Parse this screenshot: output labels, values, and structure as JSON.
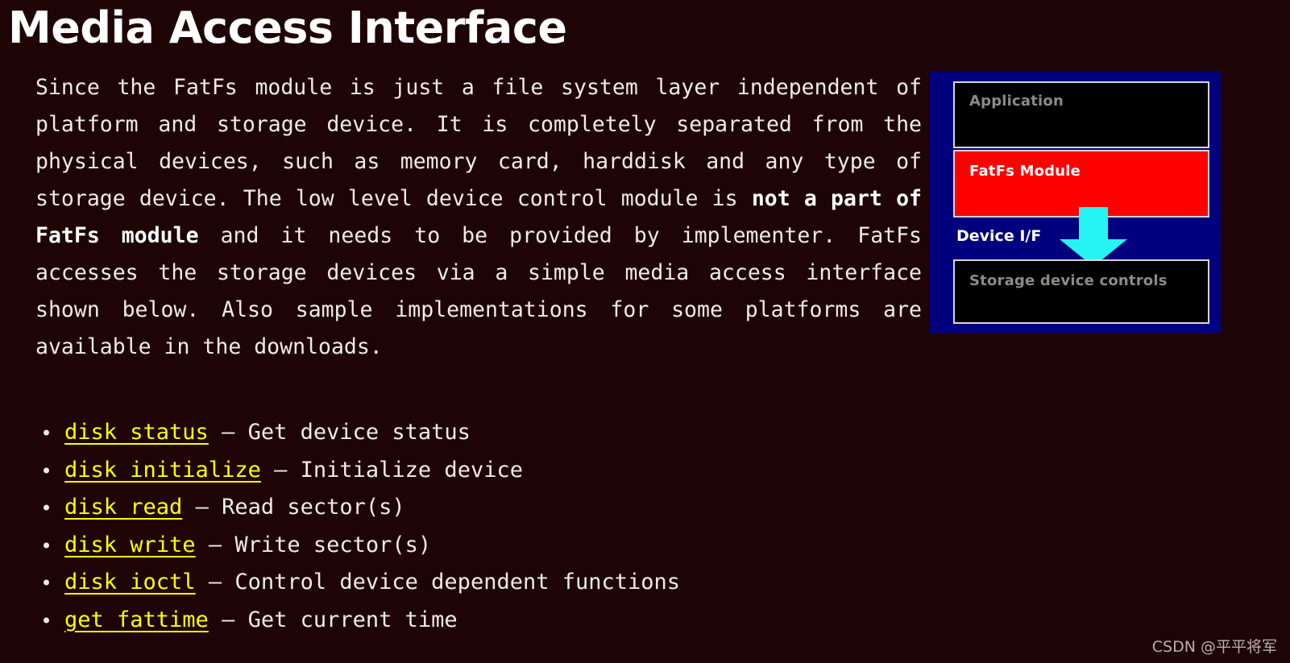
{
  "page": {
    "background_color": "#1e0404",
    "title": "Media Access Interface"
  },
  "intro": {
    "text_part1": "Since the FatFs module is just a file system layer independent of platform and storage device. It is completely separated from the physical devices, such as memory card, harddisk and any type of storage device. The low level device control module is ",
    "emphasis": "not a part of FatFs module",
    "text_part2": " and it needs to be provided by implementer. FatFs accesses the storage devices via a simple media access interface shown below. Also sample implementations for some platforms are available in the downloads."
  },
  "api_list": [
    {
      "name": "disk status",
      "separator": " – ",
      "description": "Get device status"
    },
    {
      "name": "disk initialize",
      "separator": " – ",
      "description": "Initialize device"
    },
    {
      "name": "disk read",
      "separator": " – ",
      "description": "Read sector(s)"
    },
    {
      "name": "disk write",
      "separator": " – ",
      "description": "Write sector(s)"
    },
    {
      "name": "disk ioctl",
      "separator": " – ",
      "description": "Control device dependent functions"
    },
    {
      "name": "get fattime",
      "separator": " – ",
      "description": "Get current time"
    }
  ],
  "diagram": {
    "panel_color": "#00007e",
    "application_label": "Application",
    "fatfs_label": "FatFs Module",
    "fatfs_color": "#ff0000",
    "device_if_label": "Device I/F",
    "arrow_color": "#26f4f4",
    "storage_label": "Storage device controls"
  },
  "watermark": {
    "text": "CSDN @平平将军"
  }
}
